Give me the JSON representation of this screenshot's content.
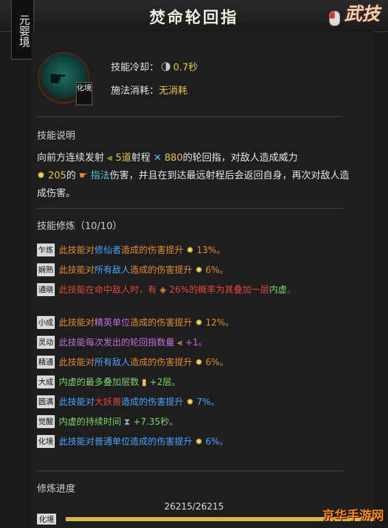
{
  "header": {
    "title": "焚命轮回指",
    "tab_label": "武技",
    "realm_tag": "元婴境"
  },
  "skill": {
    "realm_badge": "化境",
    "cooldown_label": "技能冷却：",
    "cooldown_value": "0.7秒",
    "cost_label": "施法消耗：",
    "cost_value": "无消耗"
  },
  "description": {
    "heading": "技能说明",
    "p1": "向前方连续发射",
    "count": "5道",
    "p2": "射程",
    "range": "880",
    "p3": "的轮回指，对敌人造成威力",
    "power": "205",
    "p4": "的",
    "dmg_type": "指法",
    "p5": "伤害，并且在到达最远射程后会返回自身，再次对敌人造成伤害。"
  },
  "training": {
    "heading": "技能修炼（10/10）",
    "rows": [
      {
        "tag": "乍炼",
        "a": "此技能对",
        "b": "修仙者",
        "c": "造成的伤害提升",
        "d": "13%。"
      },
      {
        "tag": "娴熟",
        "a": "此技能对",
        "b": "所有敌人",
        "c": "造成的伤害提升",
        "d": "6%。"
      },
      {
        "tag": "通晓",
        "a": "此技能在命中敌人时，有",
        "b": "26%的概率为其叠加一层",
        "c": "内虚",
        "d": "。"
      },
      {
        "tag": "小成",
        "a": "此技能对",
        "b": "精英单位",
        "c": "造成的伤害提升",
        "d": "12%。"
      },
      {
        "tag": "灵动",
        "a": "此技能每次发出的轮回指数量",
        "b": "+1。",
        "c": "",
        "d": ""
      },
      {
        "tag": "精通",
        "a": "此技能对",
        "b": "所有敌人",
        "c": "造成的伤害提升",
        "d": "6%。"
      },
      {
        "tag": "大成",
        "a": "内虚的最多叠加层数",
        "b": "+2层。",
        "c": "",
        "d": ""
      },
      {
        "tag": "圆满",
        "a": "此技能对",
        "b": "大妖兽",
        "c": "造成的伤害提升",
        "d": "7%。"
      },
      {
        "tag": "觉醒",
        "a": "内虚的持续时间",
        "b": "+7.35秒。",
        "c": "",
        "d": ""
      },
      {
        "tag": "化境",
        "a": "此技能对",
        "b": "普通单位",
        "c": "造成的伤害提升",
        "d": "6%。"
      }
    ]
  },
  "progress": {
    "heading": "修炼进度",
    "value": "26215/26215",
    "fraction": 1.0,
    "tag": "化境"
  },
  "watermark": "京华手游网"
}
